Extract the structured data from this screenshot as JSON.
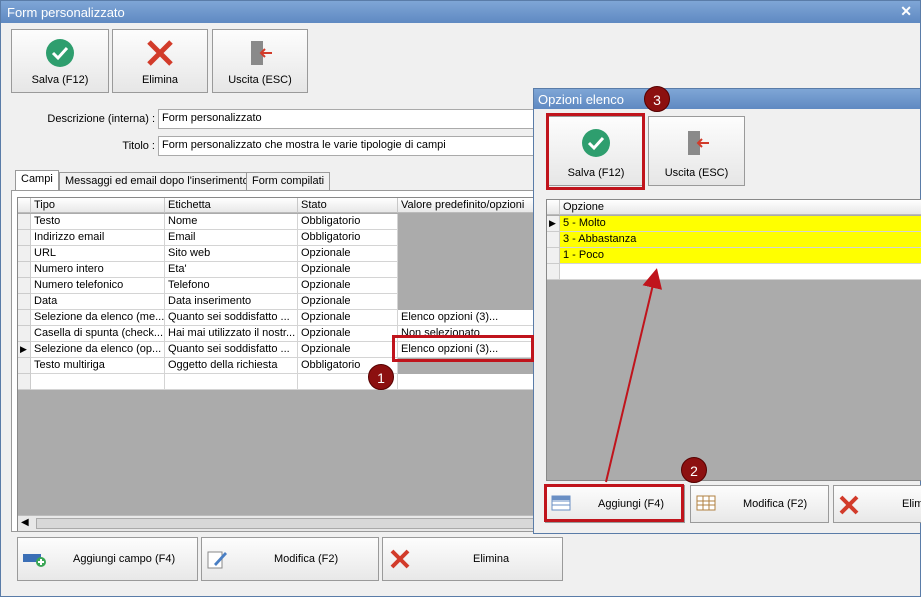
{
  "main": {
    "title": "Form personalizzato",
    "toolbar": {
      "save": "Salva (F12)",
      "delete": "Elimina",
      "exit": "Uscita (ESC)"
    },
    "desc_label": "Descrizione (interna) :",
    "desc_value": "Form personalizzato",
    "title_label": "Titolo :",
    "title_value": "Form personalizzato che mostra le varie tipologie di campi",
    "tabs": [
      "Campi",
      "Messaggi ed email dopo l'inserimento",
      "Form compilati"
    ],
    "columns": [
      "Tipo",
      "Etichetta",
      "Stato",
      "Valore predefinito/opzioni"
    ],
    "rows": [
      [
        "Testo",
        "Nome",
        "Obbligatorio",
        ""
      ],
      [
        "Indirizzo email",
        "Email",
        "Obbligatorio",
        ""
      ],
      [
        "URL",
        "Sito web",
        "Opzionale",
        ""
      ],
      [
        "Numero intero",
        "Eta'",
        "Opzionale",
        ""
      ],
      [
        "Numero telefonico",
        "Telefono",
        "Opzionale",
        ""
      ],
      [
        "Data",
        "Data inserimento",
        "Opzionale",
        ""
      ],
      [
        "Selezione da elenco (me...",
        "Quanto sei soddisfatto ...",
        "Opzionale",
        "Elenco opzioni (3)..."
      ],
      [
        "Casella di spunta (check...",
        "Hai mai utilizzato il nostr...",
        "Opzionale",
        "Non selezionato"
      ],
      [
        "Selezione da elenco (op...",
        "Quanto sei soddisfatto ...",
        "Opzionale",
        "Elenco opzioni (3)..."
      ],
      [
        "Testo multiriga",
        "Oggetto della richiesta",
        "Obbligatorio",
        ""
      ]
    ],
    "bottom": {
      "add": "Aggiungi campo (F4)",
      "edit": "Modifica (F2)",
      "delete": "Elimina"
    }
  },
  "dialog": {
    "title": "Opzioni elenco",
    "toolbar": {
      "save": "Salva (F12)",
      "exit": "Uscita (ESC)"
    },
    "column": "Opzione",
    "rows": [
      "5 - Molto",
      "3 - Abbastanza",
      "1 - Poco"
    ],
    "bottom": {
      "add": "Aggiungi (F4)",
      "edit": "Modifica (F2)",
      "delete": "Elimina"
    }
  },
  "badges": [
    "1",
    "2",
    "3"
  ],
  "colors": {
    "accent": "#5f89c2",
    "highlight": "#ffff00",
    "annotation": "#c0141c",
    "check": "#2e9e6e"
  }
}
